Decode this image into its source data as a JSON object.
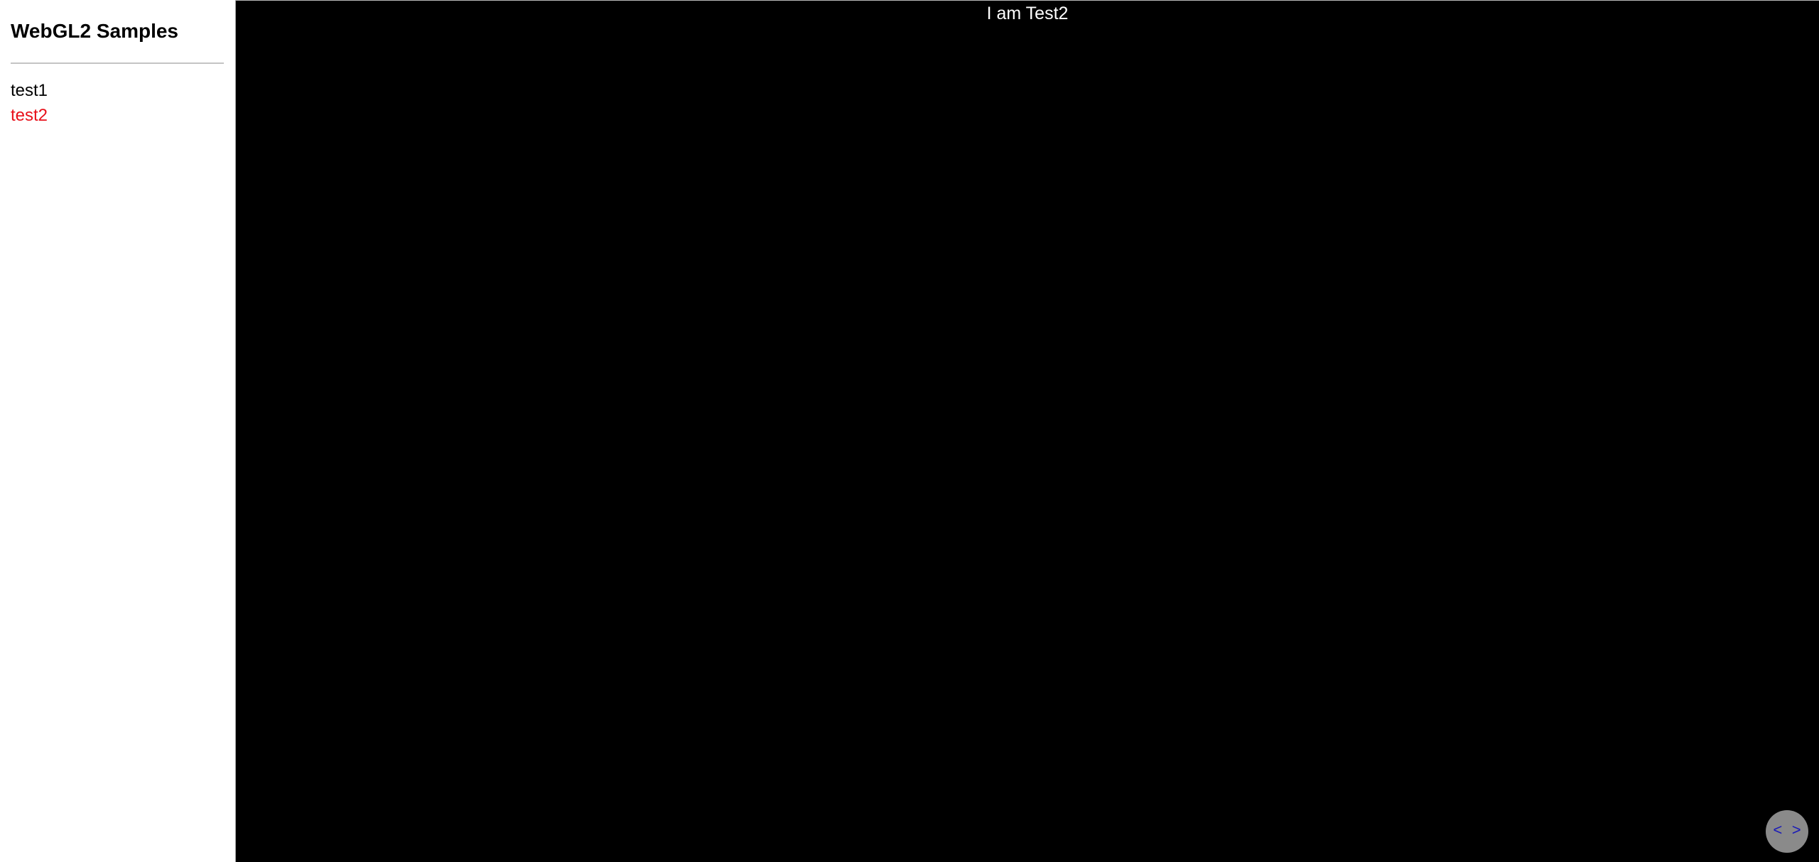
{
  "sidebar": {
    "title": "WebGL2 Samples",
    "items": [
      {
        "label": "test1",
        "active": false
      },
      {
        "label": "test2",
        "active": true
      }
    ]
  },
  "canvas": {
    "label": "I am Test2",
    "background": "#000000"
  },
  "code_toggle": {
    "label": "< >",
    "icon": "code-brackets-icon"
  },
  "colors": {
    "active_item": "#e8101a",
    "toggle_bg": "#8a8a8a",
    "toggle_text": "#1a1ab8"
  }
}
